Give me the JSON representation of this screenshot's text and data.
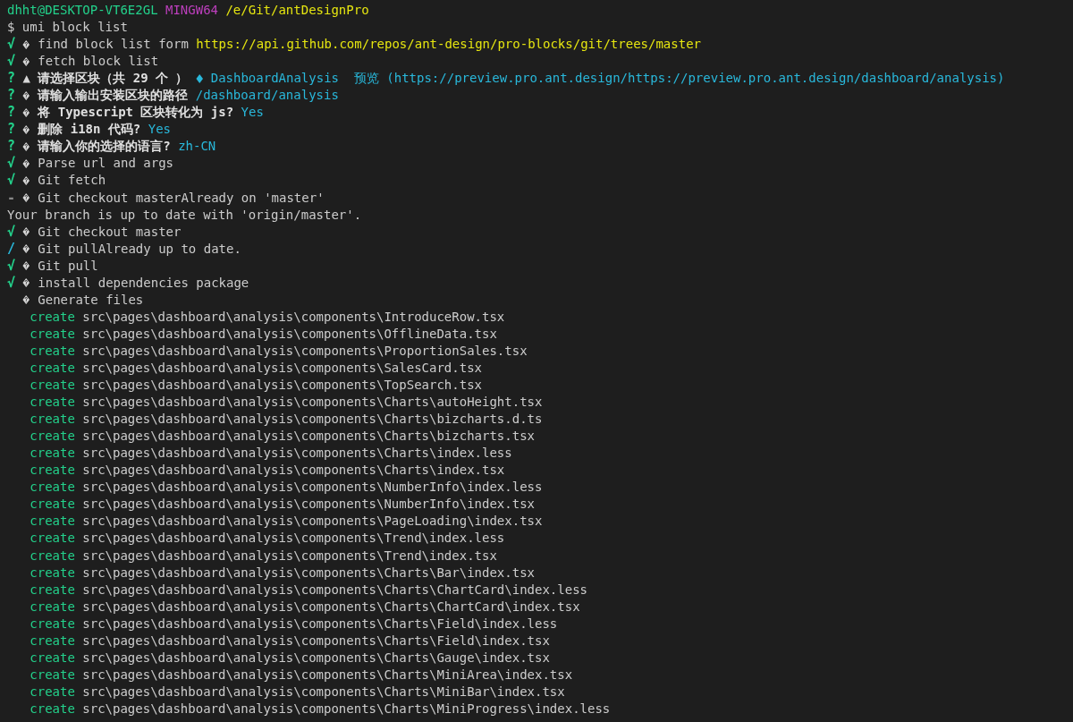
{
  "prompt": {
    "user_host": "dhht@DESKTOP-VT6E2GL",
    "shell": "MINGW64",
    "path": "/e/Git/antDesignPro"
  },
  "command": {
    "symbol": "$",
    "text": "umi block list"
  },
  "lines": [
    {
      "kind": "step",
      "mark": "√",
      "color": "#23d18b",
      "text": "find block list form",
      "url": "https://api.github.com/repos/ant-design/pro-blocks/git/trees/master"
    },
    {
      "kind": "step",
      "mark": "√",
      "color": "#23d18b",
      "text": "fetch block list"
    },
    {
      "kind": "select",
      "mark": "?",
      "color": "#23d18b",
      "symbol": "▲",
      "text": "请选择区块（共 29 个 ）",
      "answer": "DashboardAnalysis  预览 (https://preview.pro.ant.design/https://preview.pro.ant.design/dashboard/analysis)"
    },
    {
      "kind": "question",
      "mark": "?",
      "color": "#23d18b",
      "text": "请输入输出安装区块的路径",
      "answer": "/dashboard/analysis"
    },
    {
      "kind": "question",
      "mark": "?",
      "color": "#23d18b",
      "text": "将 Typescript 区块转化为 js?",
      "answer": "Yes"
    },
    {
      "kind": "question",
      "mark": "?",
      "color": "#23d18b",
      "text": "删除 i18n 代码?",
      "answer": "Yes"
    },
    {
      "kind": "question",
      "mark": "?",
      "color": "#23d18b",
      "text": "请输入你的选择的语言?",
      "answer": "zh-CN"
    },
    {
      "kind": "step",
      "mark": "√",
      "color": "#23d18b",
      "text": "Parse url and args"
    },
    {
      "kind": "step",
      "mark": "√",
      "color": "#23d18b",
      "text": "Git fetch"
    },
    {
      "kind": "step",
      "mark": "-",
      "color": "#888888",
      "text": "Git checkout masterAlready on 'master'"
    },
    {
      "kind": "plain",
      "text": "Your branch is up to date with 'origin/master'."
    },
    {
      "kind": "step",
      "mark": "√",
      "color": "#23d18b",
      "text": "Git checkout master"
    },
    {
      "kind": "step",
      "mark": "/",
      "color": "#29b8db",
      "text": "Git pullAlready up to date."
    },
    {
      "kind": "step",
      "mark": "√",
      "color": "#23d18b",
      "text": "Git pull"
    },
    {
      "kind": "step",
      "mark": "√",
      "color": "#23d18b",
      "text": "install dependencies package"
    },
    {
      "kind": "step",
      "text": "Generate files"
    },
    {
      "kind": "file",
      "action": "create",
      "path": "src\\pages\\dashboard\\analysis\\components\\IntroduceRow.tsx"
    },
    {
      "kind": "file",
      "action": "create",
      "path": "src\\pages\\dashboard\\analysis\\components\\OfflineData.tsx"
    },
    {
      "kind": "file",
      "action": "create",
      "path": "src\\pages\\dashboard\\analysis\\components\\ProportionSales.tsx"
    },
    {
      "kind": "file",
      "action": "create",
      "path": "src\\pages\\dashboard\\analysis\\components\\SalesCard.tsx"
    },
    {
      "kind": "file",
      "action": "create",
      "path": "src\\pages\\dashboard\\analysis\\components\\TopSearch.tsx"
    },
    {
      "kind": "file",
      "action": "create",
      "path": "src\\pages\\dashboard\\analysis\\components\\Charts\\autoHeight.tsx"
    },
    {
      "kind": "file",
      "action": "create",
      "path": "src\\pages\\dashboard\\analysis\\components\\Charts\\bizcharts.d.ts"
    },
    {
      "kind": "file",
      "action": "create",
      "path": "src\\pages\\dashboard\\analysis\\components\\Charts\\bizcharts.tsx"
    },
    {
      "kind": "file",
      "action": "create",
      "path": "src\\pages\\dashboard\\analysis\\components\\Charts\\index.less"
    },
    {
      "kind": "file",
      "action": "create",
      "path": "src\\pages\\dashboard\\analysis\\components\\Charts\\index.tsx"
    },
    {
      "kind": "file",
      "action": "create",
      "path": "src\\pages\\dashboard\\analysis\\components\\NumberInfo\\index.less"
    },
    {
      "kind": "file",
      "action": "create",
      "path": "src\\pages\\dashboard\\analysis\\components\\NumberInfo\\index.tsx"
    },
    {
      "kind": "file",
      "action": "create",
      "path": "src\\pages\\dashboard\\analysis\\components\\PageLoading\\index.tsx"
    },
    {
      "kind": "file",
      "action": "create",
      "path": "src\\pages\\dashboard\\analysis\\components\\Trend\\index.less"
    },
    {
      "kind": "file",
      "action": "create",
      "path": "src\\pages\\dashboard\\analysis\\components\\Trend\\index.tsx"
    },
    {
      "kind": "file",
      "action": "create",
      "path": "src\\pages\\dashboard\\analysis\\components\\Charts\\Bar\\index.tsx"
    },
    {
      "kind": "file",
      "action": "create",
      "path": "src\\pages\\dashboard\\analysis\\components\\Charts\\ChartCard\\index.less"
    },
    {
      "kind": "file",
      "action": "create",
      "path": "src\\pages\\dashboard\\analysis\\components\\Charts\\ChartCard\\index.tsx"
    },
    {
      "kind": "file",
      "action": "create",
      "path": "src\\pages\\dashboard\\analysis\\components\\Charts\\Field\\index.less"
    },
    {
      "kind": "file",
      "action": "create",
      "path": "src\\pages\\dashboard\\analysis\\components\\Charts\\Field\\index.tsx"
    },
    {
      "kind": "file",
      "action": "create",
      "path": "src\\pages\\dashboard\\analysis\\components\\Charts\\Gauge\\index.tsx"
    },
    {
      "kind": "file",
      "action": "create",
      "path": "src\\pages\\dashboard\\analysis\\components\\Charts\\MiniArea\\index.tsx"
    },
    {
      "kind": "file",
      "action": "create",
      "path": "src\\pages\\dashboard\\analysis\\components\\Charts\\MiniBar\\index.tsx"
    },
    {
      "kind": "file",
      "action": "create",
      "path": "src\\pages\\dashboard\\analysis\\components\\Charts\\MiniProgress\\index.less"
    }
  ]
}
